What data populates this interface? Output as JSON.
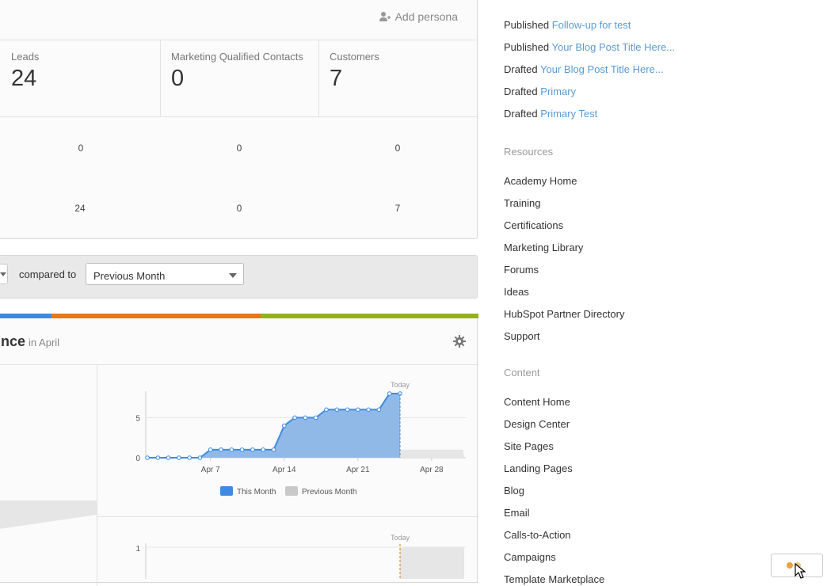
{
  "persona_card": {
    "add_persona": "Add persona",
    "metrics": [
      {
        "label": "Leads",
        "value": "24"
      },
      {
        "label": "Marketing Qualified Contacts",
        "value": "0"
      },
      {
        "label": "Customers",
        "value": "7"
      }
    ],
    "rows": [
      [
        "0",
        "0",
        "0"
      ],
      [
        "24",
        "0",
        "7"
      ]
    ]
  },
  "compare": {
    "label": "compared to",
    "selected": "Previous Month"
  },
  "performance": {
    "title": "nce",
    "subtitle": "in April",
    "colors": [
      "#3f8ae0",
      "#e67817",
      "#94b01b"
    ]
  },
  "chart_data": [
    {
      "type": "area",
      "today_label": "Today",
      "x_ticks": [
        "Apr 7",
        "Apr 14",
        "Apr 21",
        "Apr 28"
      ],
      "y_ticks": [
        "0",
        "5"
      ],
      "ylim": [
        0,
        8
      ],
      "series": [
        {
          "name": "This Month",
          "color": "#3f8ae0",
          "x": [
            1,
            2,
            3,
            4,
            5,
            6,
            7,
            8,
            9,
            10,
            11,
            12,
            13,
            14,
            15,
            16,
            17,
            18,
            19,
            20,
            21,
            22,
            23,
            24,
            25
          ],
          "values": [
            0,
            0,
            0,
            0,
            0,
            0,
            1,
            1,
            1,
            1,
            1,
            1,
            1,
            4,
            5,
            5,
            5,
            6,
            6,
            6,
            6,
            6,
            6,
            8,
            8
          ]
        },
        {
          "name": "Previous Month",
          "color": "#c8c8c8",
          "x": [
            25,
            26,
            27,
            28,
            29,
            30,
            31
          ],
          "values": [
            1,
            1,
            1,
            1,
            1,
            1,
            1
          ]
        }
      ],
      "legend": [
        "This Month",
        "Previous Month"
      ]
    },
    {
      "type": "area",
      "today_label": "Today",
      "y_ticks": [
        "1"
      ],
      "ylim": [
        0,
        1
      ],
      "series": [
        {
          "name": "Previous Month",
          "color": "#c8c8c8",
          "x": [
            25,
            26,
            27,
            28,
            29,
            30,
            31
          ],
          "values": [
            1,
            1,
            1,
            1,
            1,
            1,
            1
          ]
        }
      ]
    }
  ],
  "sidebar": {
    "activity": [
      {
        "action": "Published",
        "link": "Follow-up for test"
      },
      {
        "action": "Published",
        "link": "Your Blog Post Title Here..."
      },
      {
        "action": "Drafted",
        "link": "Your Blog Post Title Here..."
      },
      {
        "action": "Drafted",
        "link": "Primary"
      },
      {
        "action": "Drafted",
        "link": "Primary Test"
      }
    ],
    "resources_heading": "Resources",
    "resources": [
      "Academy Home",
      "Training",
      "Certifications",
      "Marketing Library",
      "Forums",
      "Ideas",
      "HubSpot Partner Directory",
      "Support"
    ],
    "content_heading": "Content",
    "content": [
      "Content Home",
      "Design Center",
      "Site Pages",
      "Landing Pages",
      "Blog",
      "Email",
      "Calls-to-Action",
      "Campaigns",
      "Template Marketplace"
    ]
  }
}
